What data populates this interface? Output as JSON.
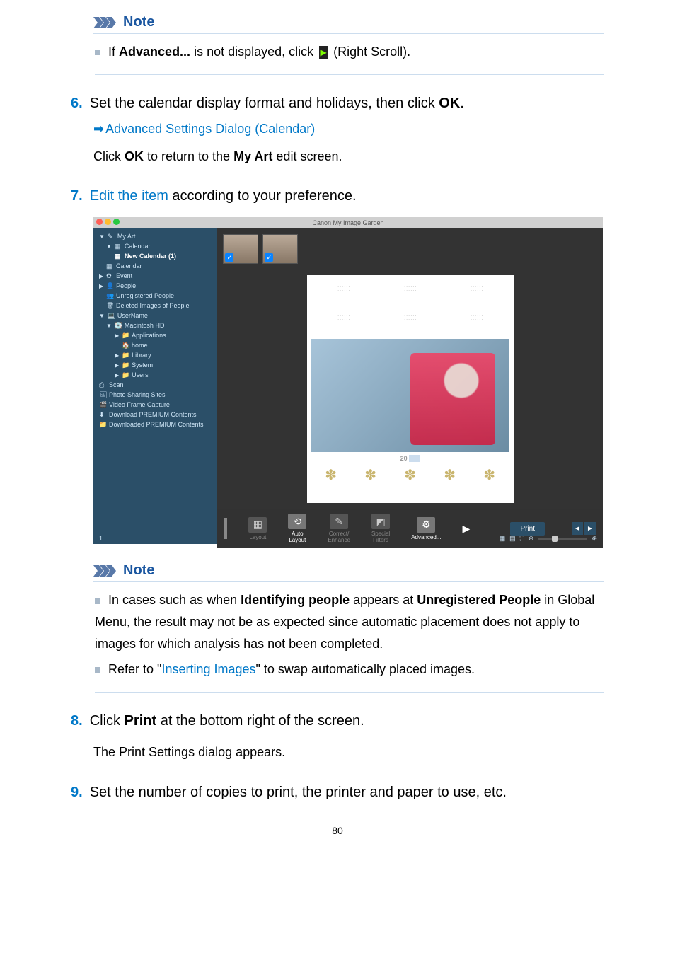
{
  "note1": {
    "heading": "Note",
    "item1_a": "If ",
    "item1_b": "Advanced...",
    "item1_c": " is not displayed, click ",
    "item1_d": " (Right Scroll)."
  },
  "step6": {
    "num": "6.",
    "text_a": "Set the calendar display format and holidays, then click ",
    "text_b": "OK",
    "text_c": ".",
    "link": "Advanced Settings Dialog (Calendar)",
    "sub_a": "Click ",
    "sub_b": "OK",
    "sub_c": " to return to the ",
    "sub_d": "My Art",
    "sub_e": " edit screen."
  },
  "step7": {
    "num": "7.",
    "link": "Edit the item",
    "text_rest": " according to your preference."
  },
  "screenshot": {
    "title": "Canon My Image Garden",
    "sidebar": {
      "my_art": "My Art",
      "calendar": "Calendar",
      "new_calendar": "New Calendar (1)",
      "calendar2": "Calendar",
      "event": "Event",
      "people": "People",
      "unreg": "Unregistered People",
      "deleted": "Deleted Images of People",
      "username": "UserName",
      "mac": "Macintosh HD",
      "apps": "Applications",
      "home": "home",
      "library": "Library",
      "system": "System",
      "users": "Users",
      "scan": "Scan",
      "photo_sharing": "Photo Sharing Sites",
      "video": "Video Frame Capture",
      "dl_premium": "Download PREMIUM Contents",
      "dled_premium": "Downloaded PREMIUM Contents"
    },
    "canvas": {
      "year": "20"
    },
    "toolbar": {
      "layout": "Layout",
      "auto_layout": "Auto\nLayout",
      "correct": "Correct/\nEnhance",
      "special": "Special\nFilters",
      "advanced": "Advanced...",
      "print": "Print"
    },
    "status_left": "1"
  },
  "note2": {
    "heading": "Note",
    "item1_a": "In cases such as when ",
    "item1_b": "Identifying people",
    "item1_c": " appears at ",
    "item1_d": "Unregistered People",
    "item1_e": " in Global Menu, the result may not be as expected since automatic placement does not apply to images for which analysis has not been completed.",
    "item2_a": "Refer to \"",
    "item2_link": "Inserting Images",
    "item2_c": "\" to swap automatically placed images."
  },
  "step8": {
    "num": "8.",
    "text_a": "Click ",
    "text_b": "Print",
    "text_c": " at the bottom right of the screen.",
    "sub": "The Print Settings dialog appears."
  },
  "step9": {
    "num": "9.",
    "text": "Set the number of copies to print, the printer and paper to use, etc."
  },
  "page_number": "80"
}
